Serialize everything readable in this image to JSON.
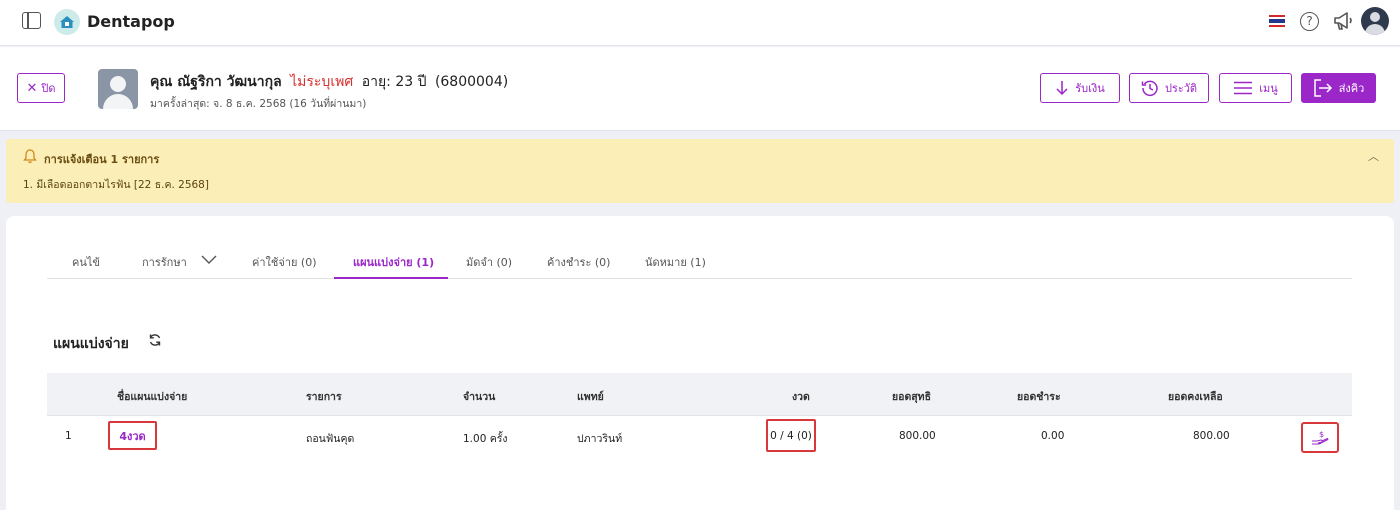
{
  "app": {
    "brand": "Dentapop"
  },
  "patient": {
    "close_label": "ปิด",
    "name": "คุณ ณัฐริกา วัฒนากุล",
    "gender": "ไม่ระบุเพศ",
    "age": "อายุ: 23 ปี",
    "patient_id": "(6800004)",
    "last_visit": "มาครั้งล่าสุด: จ. 8 ธ.ค. 2568 (16 วันที่ผ่านมา)"
  },
  "actions": {
    "receive": "รับเงิน",
    "history": "ประวัติ",
    "menu": "เมนู",
    "send_queue": "ส่งคิว"
  },
  "alert": {
    "title": "การแจ้งเตือน 1 รายการ",
    "lines": [
      "1. มีเลือดออกตามไรฟัน [22 ธ.ค. 2568]"
    ]
  },
  "tabs": [
    {
      "label": "คนไข้"
    },
    {
      "label": "การรักษา"
    },
    {
      "label": "ค่าใช้จ่าย (0)"
    },
    {
      "label": "แผนแบ่งจ่าย (1)"
    },
    {
      "label": "มัดจำ (0)"
    },
    {
      "label": "ค้างชำระ (0)"
    },
    {
      "label": "นัดหมาย (1)"
    }
  ],
  "section": {
    "title": "แผนแบ่งจ่าย"
  },
  "table": {
    "columns": [
      "ชื่อแผนแบ่งจ่าย",
      "รายการ",
      "จำนวน",
      "แพทย์",
      "งวด",
      "ยอดสุทธิ",
      "ยอดชำระ",
      "ยอดคงเหลือ"
    ],
    "rows": [
      {
        "no": "1",
        "plan": "4งวด",
        "item": "ถอนฟันคุด",
        "qty": "1.00 ครั้ง",
        "doctor": "ปภาวรินท์",
        "installment": "0 / 4 (0)",
        "net": "800.00",
        "paid": "0.00",
        "balance": "800.00"
      }
    ]
  },
  "colors": {
    "accent": "#9b27c9",
    "alert_bg": "#fbeeb6",
    "highlight": "#d9383a"
  }
}
